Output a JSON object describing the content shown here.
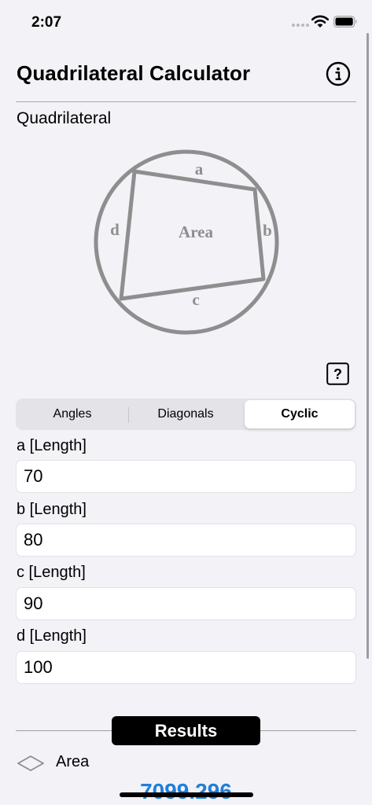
{
  "status_bar": {
    "time": "2:07"
  },
  "header": {
    "title": "Quadrilateral Calculator"
  },
  "section": {
    "title": "Quadrilateral"
  },
  "diagram": {
    "side_a": "a",
    "side_b": "b",
    "side_c": "c",
    "side_d": "d",
    "center_label": "Area"
  },
  "segments": [
    {
      "label": "Angles",
      "selected": false
    },
    {
      "label": "Diagonals",
      "selected": false
    },
    {
      "label": "Cyclic",
      "selected": true
    }
  ],
  "fields": [
    {
      "label": "a [Length]",
      "value": "70"
    },
    {
      "label": "b [Length]",
      "value": "80"
    },
    {
      "label": "c [Length]",
      "value": "90"
    },
    {
      "label": "d [Length]",
      "value": "100"
    }
  ],
  "results": {
    "title": "Results",
    "area_label": "Area",
    "area_value": "7099.296"
  },
  "icons": {
    "info": "info-icon",
    "help": "help-icon",
    "area": "rhombus-icon",
    "wifi": "wifi-icon",
    "battery": "battery-icon",
    "signal": "signal-icon"
  },
  "colors": {
    "background": "#f2f2f7",
    "accent": "#1f7fdc",
    "diagram_stroke": "#8e8e8e"
  }
}
